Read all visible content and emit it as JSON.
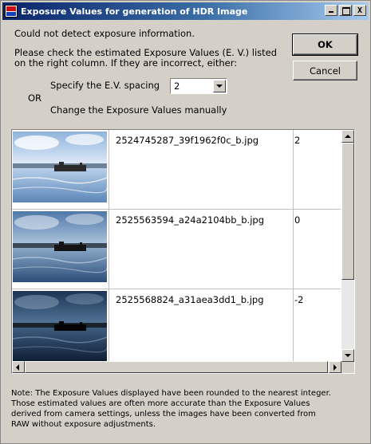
{
  "window": {
    "title": "Exposure Values for generation of HDR Image",
    "controls": {
      "minimize": "_",
      "maximize": "□",
      "close": "X"
    }
  },
  "message": {
    "detect_error": "Could not detect exposure information.",
    "instructions_line1": "Please check the estimated Exposure Values (E. V.) listed",
    "instructions_line2": "on the right column. If they are incorrect, either:",
    "or_label": "OR"
  },
  "options": {
    "spacing_label": "Specify the E.V.  spacing",
    "spacing_value": "2",
    "manual_label": "Change the Exposure Values manually"
  },
  "buttons": {
    "ok": "OK",
    "cancel": "Cancel"
  },
  "images": [
    {
      "filename": "2524745287_39f1962f0c_b.jpg",
      "ev": "2"
    },
    {
      "filename": "2525563594_a24a2104bb_b.jpg",
      "ev": "0"
    },
    {
      "filename": "2525568824_a31aea3dd1_b.jpg",
      "ev": "-2"
    }
  ],
  "note": {
    "line1": "Note: The Exposure Values displayed have been rounded to the nearest integer.",
    "line2": "Those estimated values are often more accurate than the Exposure Values",
    "line3": "derived from camera settings, unless the images have been converted from",
    "line4": "RAW without exposure adjustments."
  }
}
